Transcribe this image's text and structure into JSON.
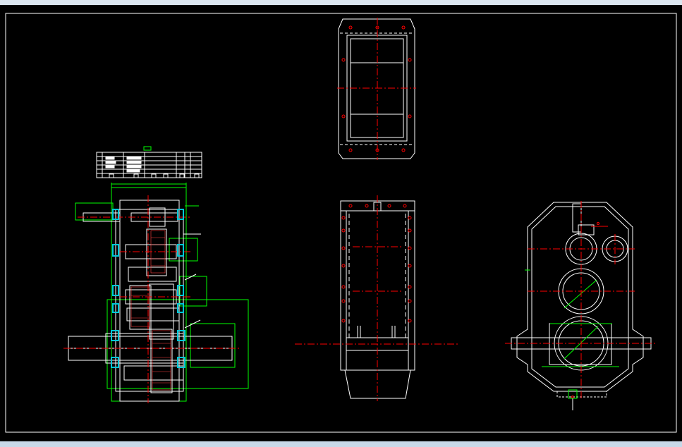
{
  "colors": {
    "background": "#000000",
    "outline": "#ffffff",
    "centerline": "#ff0000",
    "dimension": "#00ff00",
    "bearing": "#00c8d8",
    "frame": "#dce6f0"
  },
  "views": [
    "gearbox-section-view",
    "housing-top-view",
    "housing-front-view",
    "housing-side-view",
    "title-block-table"
  ]
}
